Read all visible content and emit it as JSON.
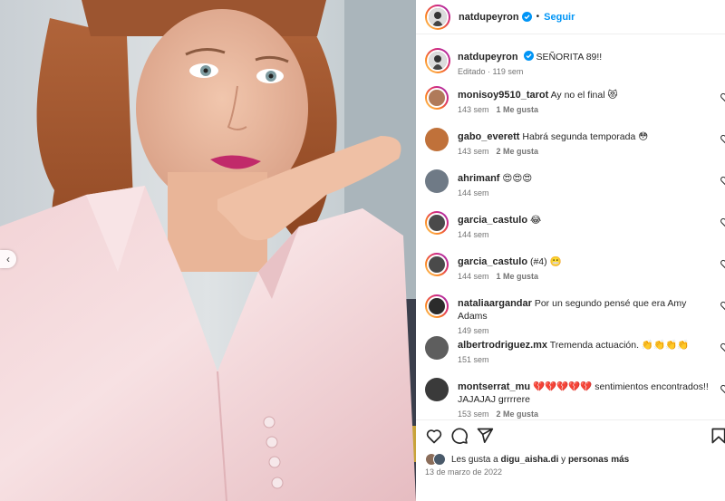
{
  "header": {
    "username": "natdupeyron",
    "dot": "•",
    "follow_label": "Seguir"
  },
  "caption": {
    "username": "natdupeyron",
    "text": "SEÑORITA 89!!",
    "meta": "Editado · 119 sem"
  },
  "comments": [
    {
      "username": "monisoy9510_tarot",
      "text": "Ay no el final 😻",
      "time": "143 sem",
      "likes": "1 Me gusta",
      "ring": true,
      "avatar_color": "#b07a5a"
    },
    {
      "username": "gabo_everett",
      "text": "Habrá segunda temporada 😳",
      "time": "143 sem",
      "likes": "2 Me gusta",
      "ring": false,
      "avatar_color": "#c0713a"
    },
    {
      "username": "ahrimanf",
      "text": "😍😍😍",
      "time": "144 sem",
      "likes": "",
      "ring": false,
      "avatar_color": "#6f7a86"
    },
    {
      "username": "garcia_castulo",
      "text": "😂",
      "time": "144 sem",
      "likes": "",
      "ring": true,
      "avatar_color": "#4a4a4a"
    },
    {
      "username": "garcia_castulo",
      "text": "(#4) 😬",
      "time": "144 sem",
      "likes": "1 Me gusta",
      "ring": true,
      "avatar_color": "#4a4a4a"
    },
    {
      "username": "nataliaargandar",
      "text": "Por un segundo pensé que era Amy Adams",
      "time": "149 sem",
      "likes": "",
      "ring": true,
      "avatar_color": "#2b2b2b"
    },
    {
      "username": "albertrodriguez.mx",
      "text": "Tremenda actuación. 👏👏👏👏",
      "time": "151 sem",
      "likes": "",
      "ring": false,
      "avatar_color": "#5e5e5e"
    },
    {
      "username": "montserrat_mu",
      "text": "💔💔💔💔💔 sentimientos encontrados!! JAJAJAJ grrrrere",
      "time": "153 sem",
      "likes": "2 Me gusta",
      "ring": false,
      "avatar_color": "#3a3a3a"
    }
  ],
  "bottom": {
    "likes_prefix": "Les gusta a ",
    "likes_user": "digu_aisha.di",
    "likes_mid": " y ",
    "likes_rest": "personas más",
    "date": "13 de marzo de 2022"
  },
  "icons": [
    "chevron-left-icon",
    "verified-badge-icon",
    "heart-icon",
    "comment-icon",
    "share-icon",
    "bookmark-icon"
  ],
  "colors": {
    "accent": "#0095f6",
    "text": "#262626",
    "muted": "#737373",
    "verified": "#0095f6"
  }
}
